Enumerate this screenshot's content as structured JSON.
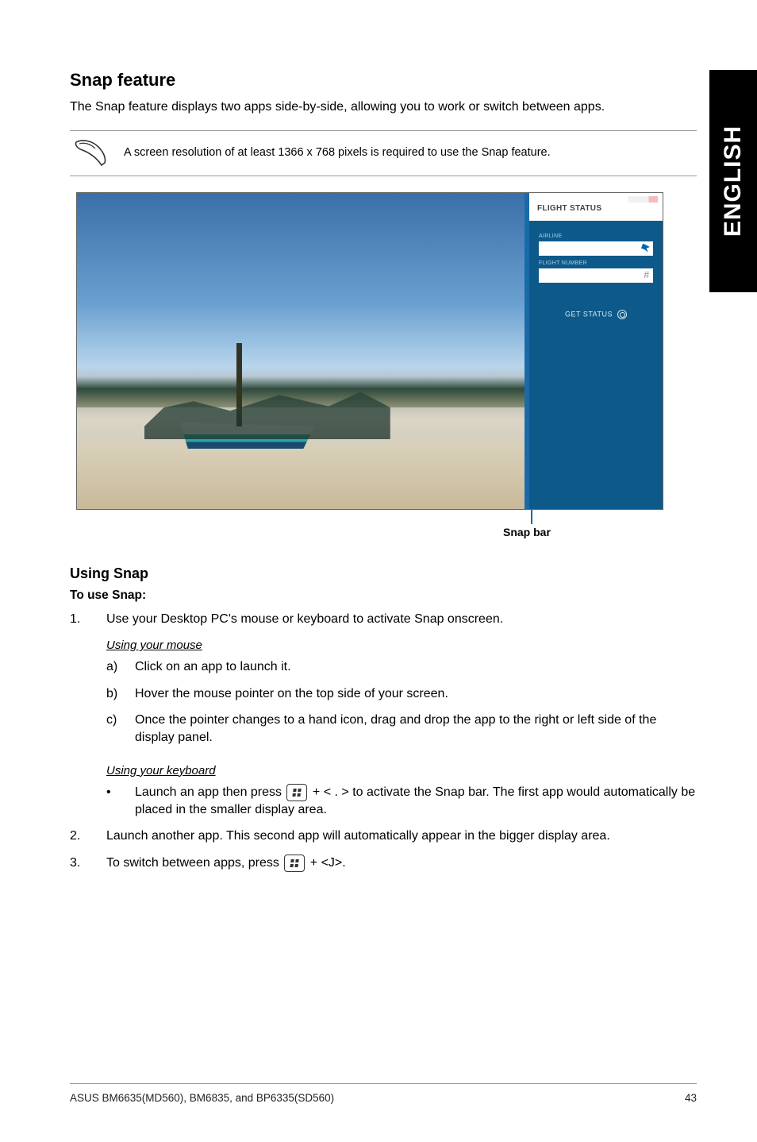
{
  "sideTab": "ENGLISH",
  "heading": "Snap feature",
  "intro": "The Snap feature displays two apps side-by-side, allowing you to work or switch between apps.",
  "note": "A screen resolution of at least 1366 x 768 pixels is required to use the Snap feature.",
  "screenshot": {
    "sidePane": {
      "title": "FLIGHT STATUS",
      "airlineLabel": "AIRLINE",
      "flightLabel": "FLIGHT NUMBER",
      "getStatus": "GET STATUS"
    }
  },
  "snapBarLabel": "Snap bar",
  "usingSnap": "Using Snap",
  "toUseSnap": "To use Snap:",
  "step1": {
    "num": "1.",
    "text": "Use your Desktop PC's mouse or keyboard to activate Snap onscreen."
  },
  "mouseHeading": "Using your mouse",
  "mouseA": {
    "marker": "a)",
    "text": "Click on an app to launch it."
  },
  "mouseB": {
    "marker": "b)",
    "text": "Hover the mouse pointer on the top side of your screen."
  },
  "mouseC": {
    "marker": "c)",
    "text": "Once the pointer changes to a hand icon, drag and drop the app to the right or left side of the display panel."
  },
  "keyboardHeading": "Using your keyboard",
  "kbBullet": {
    "marker": "•",
    "pre": "Launch an app then press ",
    "mid": " + < . > to activate the Snap bar. The first app would automatically be placed in the smaller display area."
  },
  "step2": {
    "num": "2.",
    "text": "Launch another app. This second app will automatically appear in the bigger display area."
  },
  "step3": {
    "num": "3.",
    "pre": "To switch between apps, press ",
    "post": " + <J>."
  },
  "footer": {
    "left": "ASUS BM6635(MD560), BM6835, and BP6335(SD560)",
    "right": "43"
  }
}
